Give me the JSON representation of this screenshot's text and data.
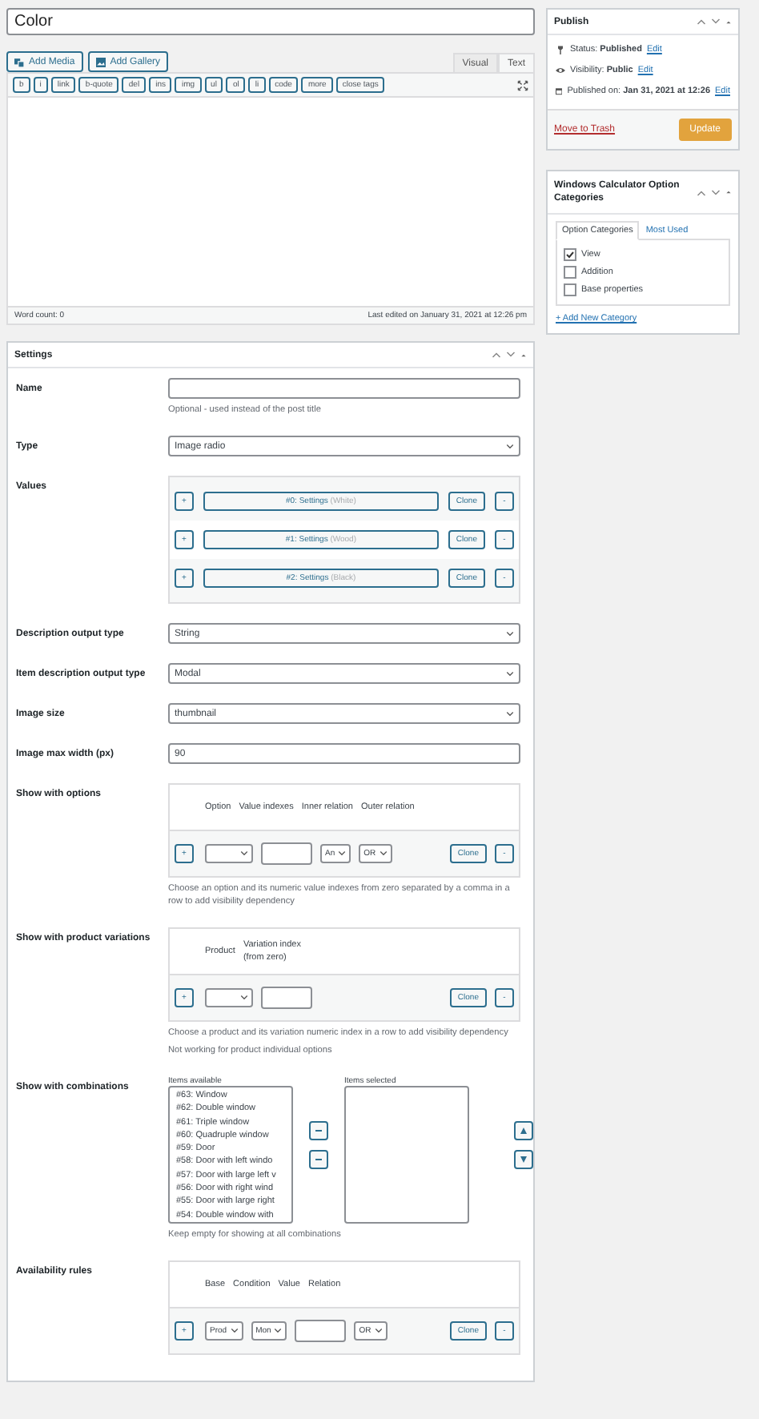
{
  "title_field": {
    "value": "Color"
  },
  "media_buttons": [
    {
      "kind": "media",
      "label": "Add Media"
    },
    {
      "kind": "gallery",
      "label": "Add Gallery"
    }
  ],
  "editor_tabs": [
    {
      "label": "Visual",
      "selected": false
    },
    {
      "label": "Text",
      "selected": true
    }
  ],
  "quicktags": [
    "b",
    "i",
    "link",
    "b-quote",
    "del",
    "ins",
    "img",
    "ul",
    "ol",
    "li",
    "code",
    "more",
    "close tags"
  ],
  "editor_status": {
    "word_count": "Word count: 0",
    "last_edited": "Last edited on January 31, 2021 at 12:26 pm"
  },
  "publish": {
    "title": "Publish",
    "items": [
      {
        "kind": "status",
        "label": "Status:",
        "value": "Published",
        "link": "Edit"
      },
      {
        "kind": "visibility",
        "label": "Visibility:",
        "value": "Public",
        "link": "Edit"
      },
      {
        "kind": "date",
        "label": "Published on:",
        "value": "Jan 31, 2021 at 12:26",
        "link": "Edit"
      }
    ],
    "trash_link": "Move to Trash",
    "update_button": "Update"
  },
  "categories_box": {
    "title": "Windows Calculator Option Categories",
    "tabs": [
      {
        "label": "Option Categories",
        "selected": true
      },
      {
        "label": "Most Used",
        "selected": false
      }
    ],
    "items": [
      {
        "label": "View",
        "checked": true
      },
      {
        "label": "Addition",
        "checked": false
      },
      {
        "label": "Base properties",
        "checked": false
      }
    ],
    "add_link": "+ Add New Category"
  },
  "settings": {
    "title": "Settings",
    "fields": [
      {
        "kind": "text",
        "label": "Name",
        "hint": "Optional - used instead of the post title"
      },
      {
        "kind": "select",
        "label": "Type",
        "value": "Image radio"
      },
      {
        "kind": "values",
        "label": "Values",
        "rows": [
          {
            "add": "+",
            "title": "#0: Settings",
            "note": "(White)",
            "clone": "Clone",
            "remove": "-"
          },
          {
            "add": "+",
            "title": "#1: Settings",
            "note": "(Wood)",
            "clone": "Clone",
            "remove": "-"
          },
          {
            "add": "+",
            "title": "#2: Settings",
            "note": "(Black)",
            "clone": "Clone",
            "remove": "-"
          }
        ]
      },
      {
        "kind": "select",
        "label": "Description output type",
        "value": "String"
      },
      {
        "kind": "select",
        "label": "Item description output type",
        "value": "Modal"
      },
      {
        "kind": "select",
        "label": "Image size",
        "value": "thumbnail"
      },
      {
        "kind": "text",
        "label": "Image max width (px)",
        "value": "90"
      },
      {
        "kind": "table",
        "label": "Show with options",
        "columns": [
          {
            "label": "Option",
            "kind": "select"
          },
          {
            "label": "Value indexes",
            "kind": "input"
          },
          {
            "label": "Inner relation",
            "kind": "select",
            "value": "An"
          },
          {
            "label": "Outer relation",
            "kind": "select",
            "value": "OR"
          }
        ],
        "add": "+",
        "clone": "Clone",
        "remove": "-",
        "hints": [
          "Choose an option and its numeric value indexes from zero separated by a comma in a row to add visibility dependency"
        ]
      },
      {
        "kind": "table",
        "label": "Show with product variations",
        "columns": [
          {
            "label": "Product",
            "kind": "select"
          },
          {
            "label": "Variation index (from zero)",
            "kind": "input"
          }
        ],
        "add": "+",
        "clone": "Clone",
        "remove": "-",
        "hints": [
          "Choose a product and its variation numeric index in a row to add visibility dependency",
          "Not working for product individual options"
        ]
      },
      {
        "kind": "dual-list",
        "label": "Show with combinations",
        "available_label": "Items available",
        "available": [
          "#63: Window",
          "#62: Double window",
          "#61: Triple window",
          "#60: Quadruple window",
          "#59: Door",
          "#58: Door with left windo",
          "#57: Door with large left v",
          "#56: Door with right wind",
          "#55: Door with large right",
          "#54: Double window with"
        ],
        "selected_label": "Items selected",
        "hint": "Keep empty for showing at all combinations"
      },
      {
        "kind": "table",
        "label": "Availability rules",
        "columns": [
          {
            "label": "Base",
            "kind": "select",
            "value": "Prod"
          },
          {
            "label": "Condition",
            "kind": "select",
            "value": "Mon"
          },
          {
            "label": "Value",
            "kind": "input"
          },
          {
            "label": "Relation",
            "kind": "select",
            "value": "OR"
          }
        ],
        "add": "+",
        "clone": "Clone",
        "remove": "-"
      }
    ]
  }
}
